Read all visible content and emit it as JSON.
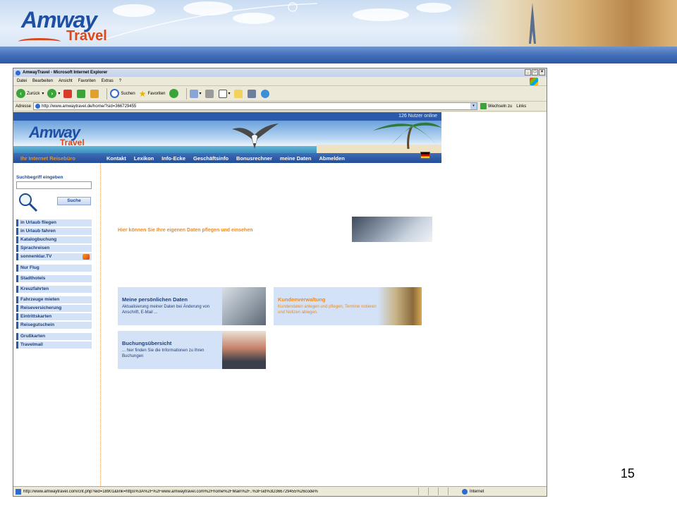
{
  "slide": {
    "logo_brand": "Amway",
    "logo_travel": "Travel",
    "page_number": "15"
  },
  "browser": {
    "window_title": "AmwayTravel - Microsoft Internet Explorer",
    "menu": [
      "Datei",
      "Bearbeiten",
      "Ansicht",
      "Favoriten",
      "Extras",
      "?"
    ],
    "toolbar": {
      "back": "Zurück",
      "search": "Suchen",
      "favorites": "Favoriten"
    },
    "address_label": "Adresse",
    "address_url": "http://www.amwaytravel.de/home/?sid=366729455",
    "go_label": "Wechseln zu",
    "links_label": "Links",
    "status_url": "http://www.amwaytravel.com/cnt.php?eid=18901&link=https%3A%2F%2Fwww.amwaytravel.com%2Fhome%2FMain%2F..%3Fsid%3D366729455%26code%",
    "status_zone": "Internet"
  },
  "site": {
    "online_count": "126 Nutzer online",
    "logo_brand": "Amway",
    "logo_travel": "Travel",
    "slogan": "Ihr Internet Reisebüro",
    "nav": [
      "Kontakt",
      "Lexikon",
      "Info-Ecke",
      "Geschäftsinfo",
      "Bonusrechner",
      "meine Daten",
      "Abmelden"
    ],
    "search_label": "Suchbegriff eingeben",
    "search_button": "Suche",
    "menu_groups": [
      [
        "in Urlaub fliegen",
        "in Urlaub fahren",
        "Katalogbuchung",
        "Sprachreisen",
        "sonnenklar.TV"
      ],
      [
        "Nur Flug"
      ],
      [
        "Stadthotels"
      ],
      [
        "Kreuzfahrten"
      ],
      [
        "Fahrzeuge mieten",
        "Reiseversicherung",
        "Eintrittskarten",
        "Reisegutschein"
      ],
      [
        "Grußkarten",
        "Travelmail"
      ]
    ],
    "welcome": "Hier können Sie Ihre eigenen Daten pflegen und einsehen",
    "cards": [
      {
        "title": "Meine persönlichen Daten",
        "desc": "Aktualisierung meiner Daten bei Änderung von Anschrift, E-Mail ..."
      },
      {
        "title": "Kundenverwaltung",
        "desc": "Kundendaten anlegen und pflegen, Termine notieren und Notizen ablegen."
      },
      {
        "title": "Buchungsübersicht",
        "desc": "... hier finden Sie die Informationen zu Ihren Buchungen"
      }
    ]
  },
  "colors": {
    "site_blue": "#2b5aa8",
    "accent_orange": "#ef8a20",
    "card_bg": "#d3e2f6"
  }
}
